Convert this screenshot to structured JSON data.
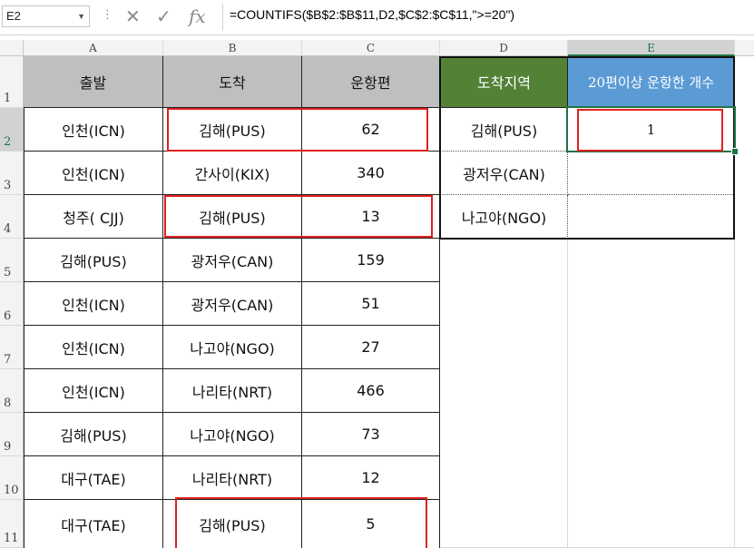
{
  "formula_bar": {
    "name_box": "E2",
    "formula": "=COUNTIFS($B$2:$B$11,D2,$C$2:$C$11,\">=20\")",
    "cancel_glyph": "✕",
    "enter_glyph": "✓",
    "fx_glyph": "fx"
  },
  "columns": [
    "A",
    "B",
    "C",
    "D",
    "E"
  ],
  "rows": [
    "1",
    "2",
    "3",
    "4",
    "5",
    "6",
    "7",
    "8",
    "9",
    "10",
    "11"
  ],
  "table_header": {
    "departure": "출발",
    "arrival": "도착",
    "flights": "운항편"
  },
  "table_rows": [
    {
      "departure": "인천(ICN)",
      "arrival": "김해(PUS)",
      "flights": "62"
    },
    {
      "departure": "인천(ICN)",
      "arrival": "간사이(KIX)",
      "flights": "340"
    },
    {
      "departure": "청주( CJJ)",
      "arrival": "김해(PUS)",
      "flights": "13"
    },
    {
      "departure": "김해(PUS)",
      "arrival": "광저우(CAN)",
      "flights": "159"
    },
    {
      "departure": "인천(ICN)",
      "arrival": "광저우(CAN)",
      "flights": "51"
    },
    {
      "departure": "인천(ICN)",
      "arrival": "나고야(NGO)",
      "flights": "27"
    },
    {
      "departure": "인천(ICN)",
      "arrival": "나리타(NRT)",
      "flights": "466"
    },
    {
      "departure": "김해(PUS)",
      "arrival": "나고야(NGO)",
      "flights": "73"
    },
    {
      "departure": "대구(TAE)",
      "arrival": "나리타(NRT)",
      "flights": "12"
    },
    {
      "departure": "대구(TAE)",
      "arrival": "김해(PUS)",
      "flights": "5"
    }
  ],
  "summary_header": {
    "destination": "도착지역",
    "count": "20편이상 운항한 개수"
  },
  "summary_rows": [
    {
      "destination": "김해(PUS)",
      "count": "1"
    },
    {
      "destination": "광저우(CAN)",
      "count": ""
    },
    {
      "destination": "나고야(NGO)",
      "count": ""
    }
  ],
  "colors": {
    "header_gray": "#bfbfbf",
    "header_green": "#538135",
    "header_blue": "#5b9bd5",
    "highlight_red": "#e02020",
    "selection_green": "#217346"
  }
}
